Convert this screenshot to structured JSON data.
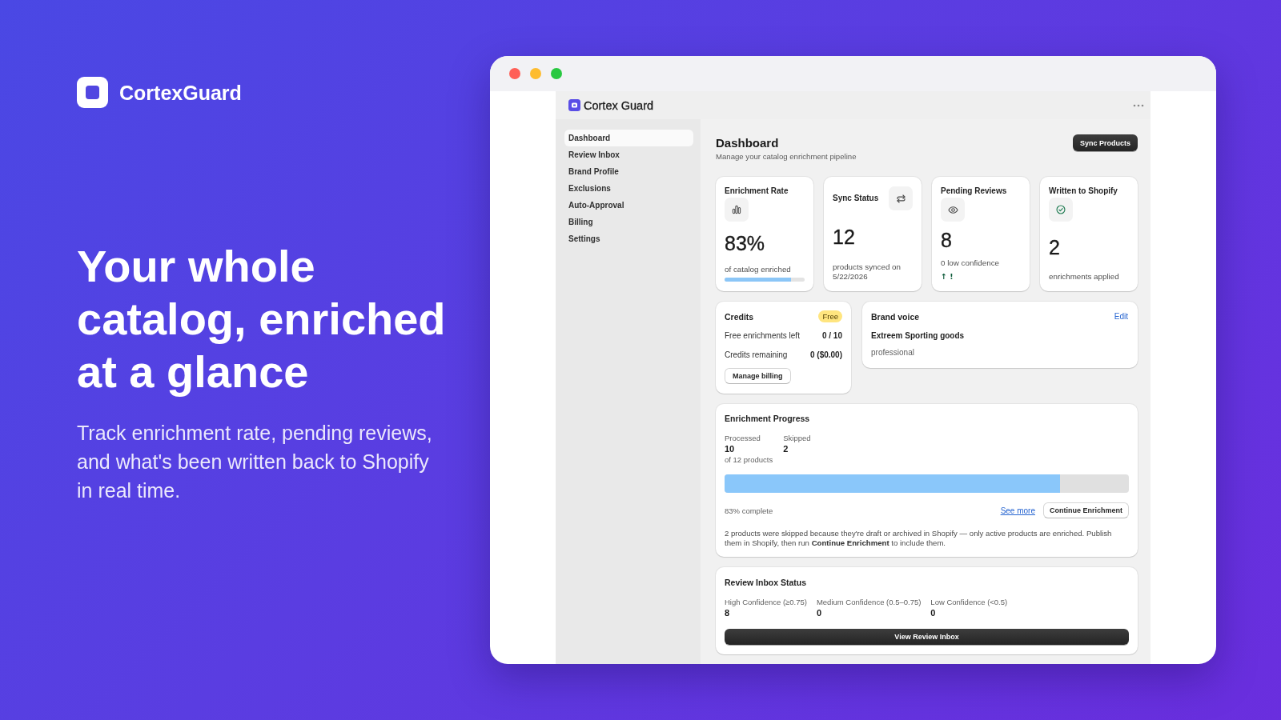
{
  "brand": {
    "name": "CortexGuard"
  },
  "hero": {
    "headline": "Your whole catalog, enriched at a glance",
    "subtitle": "Track enrichment rate, pending reviews, and what's been written back to Shopify in real time."
  },
  "app": {
    "title": "Cortex Guard"
  },
  "sidebar": {
    "items": [
      {
        "label": "Dashboard",
        "selected": true
      },
      {
        "label": "Review Inbox",
        "selected": false
      },
      {
        "label": "Brand Profile",
        "selected": false
      },
      {
        "label": "Exclusions",
        "selected": false
      },
      {
        "label": "Auto-Approval",
        "selected": false
      },
      {
        "label": "Billing",
        "selected": false
      },
      {
        "label": "Settings",
        "selected": false
      }
    ]
  },
  "page": {
    "title": "Dashboard",
    "subtitle": "Manage your catalog enrichment pipeline",
    "action": "Sync Products"
  },
  "stats": [
    {
      "kind": "rate",
      "title": "Enrichment Rate",
      "value": "83%",
      "caption": "of catalog enriched",
      "level": 0.83
    },
    {
      "kind": "sync",
      "title": "Sync Status",
      "value": "12",
      "caption": "products synced on 5/22/2026"
    },
    {
      "kind": "reviews",
      "title": "Pending Reviews",
      "value": "8",
      "caption": "0 low confidence",
      "trend": "↑ !"
    },
    {
      "kind": "written",
      "title": "Written to Shopify",
      "value": "2",
      "caption": "enrichments applied"
    }
  ],
  "credits": {
    "title": "Credits",
    "badge": "Free",
    "rows": [
      {
        "label": "Free enrichments left",
        "value": "0 / 10"
      },
      {
        "label": "Credits remaining",
        "value": "0 ($0.00)"
      }
    ],
    "button": "Manage billing"
  },
  "brand_voice": {
    "title": "Brand voice",
    "action": "Edit",
    "name": "Extreem Sporting goods",
    "tone": "professional"
  },
  "progress": {
    "title": "Enrichment Progress",
    "metrics": [
      {
        "label": "Processed",
        "value": "10",
        "note": "of 12 products"
      },
      {
        "label": "Skipped",
        "value": "2"
      }
    ],
    "level": 0.83,
    "reading": "83% complete",
    "link": "See more",
    "button": "Continue Enrichment",
    "note": "2 products were skipped because they're draft or archived in Shopify — only active products are enriched. Publish them in Shopify, then run **Continue Enrichment** to include them."
  },
  "review_inbox": {
    "title": "Review Inbox Status",
    "metrics": [
      {
        "label": "High Confidence (≥0.75)",
        "value": "8"
      },
      {
        "label": "Medium Confidence (0.5–0.75)",
        "value": "0"
      },
      {
        "label": "Low Confidence (<0.5)",
        "value": "0"
      }
    ],
    "button": "View Review Inbox"
  }
}
